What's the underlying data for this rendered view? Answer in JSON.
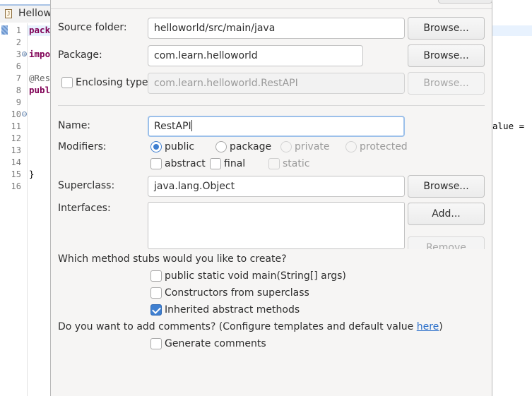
{
  "editor": {
    "tab_title": "Hellow",
    "tab_icon": "J",
    "line_numbers": [
      "1",
      "2",
      "3",
      "6",
      "7",
      "8",
      "9",
      "10",
      "11",
      "12",
      "13",
      "14",
      "15",
      "16"
    ],
    "lines": {
      "l1_kw": "pack",
      "l3_kw": "impo",
      "l7_ann": "@Res",
      "l8_kw": "publ",
      "l15_text": "}"
    },
    "right_fragment": "alue ="
  },
  "dialog": {
    "source_folder": {
      "label": "Source folder:",
      "value": "helloworld/src/main/java",
      "browse": "Browse..."
    },
    "package": {
      "label": "Package:",
      "value": "com.learn.helloworld",
      "browse": "Browse..."
    },
    "enclosing_type": {
      "label": "Enclosing type:",
      "value": "com.learn.helloworld.RestAPI",
      "browse": "Browse...",
      "checked": false
    },
    "name": {
      "label": "Name:",
      "value": "RestAPI"
    },
    "modifiers": {
      "label": "Modifiers:",
      "public": "public",
      "package": "package",
      "private": "private",
      "protected": "protected",
      "abstract": "abstract",
      "final": "final",
      "static": "static",
      "selected": "public"
    },
    "superclass": {
      "label": "Superclass:",
      "value": "java.lang.Object",
      "browse": "Browse..."
    },
    "interfaces": {
      "label": "Interfaces:",
      "add": "Add...",
      "remove": "Remove"
    },
    "stubs": {
      "question": "Which method stubs would you like to create?",
      "main": "public static void main(String[] args)",
      "constructors": "Constructors from superclass",
      "inherited": "Inherited abstract methods",
      "main_checked": false,
      "constructors_checked": false,
      "inherited_checked": true
    },
    "comments": {
      "question": "Do you want to add comments? (Configure templates and default value ",
      "link": "here",
      "question_end": ")",
      "generate": "Generate comments",
      "generate_checked": false
    }
  },
  "colors": {
    "accent": "#3f7fd0",
    "keyword": "#7f0055",
    "link": "#2a6ec9"
  }
}
